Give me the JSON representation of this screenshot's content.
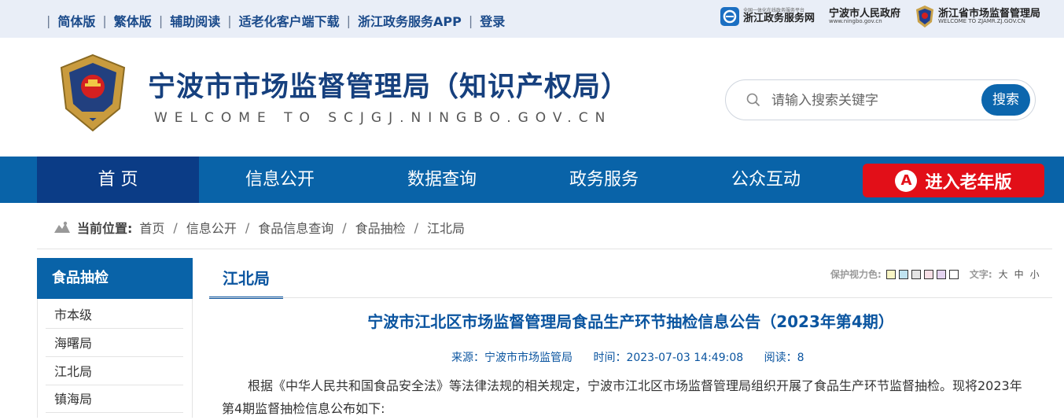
{
  "topbar": {
    "links": [
      "简体版",
      "繁体版",
      "辅助阅读",
      "适老化客户端下载",
      "浙江政务服务APP",
      "登录"
    ],
    "logos": {
      "zwfw": {
        "small": "全国一体化在线政务服务平台",
        "main": "浙江政务服务网"
      },
      "ningbo": {
        "main": "宁波市人民政府",
        "sub": "www.ningbo.gov.cn"
      },
      "zjamr": {
        "main": "浙江省市场监督管理局",
        "sub": "WELCOME TO ZJAMR.ZJ.GOV.CN"
      }
    }
  },
  "header": {
    "title": "宁波市市场监督管理局（知识产权局）",
    "subtitle": "WELCOME TO SCJGJ.NINGBO.GOV.CN",
    "search": {
      "placeholder": "请输入搜索关键字",
      "button": "搜索"
    }
  },
  "nav": {
    "items": [
      "首 页",
      "信息公开",
      "数据查询",
      "政务服务",
      "公众互动"
    ],
    "elder": {
      "badge": "A",
      "label": "进入老年版"
    }
  },
  "breadcrumb": {
    "label": "当前位置:",
    "items": [
      "首页",
      "信息公开",
      "食品信息查询",
      "食品抽检",
      "江北局"
    ]
  },
  "sidebar": {
    "title": "食品抽检",
    "items": [
      "市本级",
      "海曙局",
      "江北局",
      "镇海局"
    ]
  },
  "content": {
    "tab": "江北局",
    "tools": {
      "color_label": "保护视力色:",
      "swatches": [
        "#f9f5c4",
        "#bfe3f0",
        "#e4e4e4",
        "#f7dfe6",
        "#e4d3f0",
        "#ffffff"
      ],
      "font_label": "文字:",
      "font_sizes": [
        "大",
        "中",
        "小"
      ]
    },
    "article": {
      "title": "宁波市江北区市场监督管理局食品生产环节抽检信息公告（2023年第4期）",
      "source": "来源：宁波市市场监管局",
      "time": "时间：2023-07-03 14:49:08",
      "reads": "阅读：8",
      "body": "根据《中华人民共和国食品安全法》等法律法规的相关规定，宁波市江北区市场监督管理局组织开展了食品生产环节监督抽检。现将2023年第4期监督抽检信息公布如下:"
    }
  },
  "colors": {
    "primary": "#0963a8",
    "nav_active": "#0b3c86",
    "elder": "#e20f18",
    "title": "#16407e"
  },
  "icons": [
    "zwfw-logo-icon",
    "ningbo-gov-icon",
    "zjamr-emblem-icon",
    "site-emblem-icon",
    "search-icon",
    "location-icon"
  ]
}
